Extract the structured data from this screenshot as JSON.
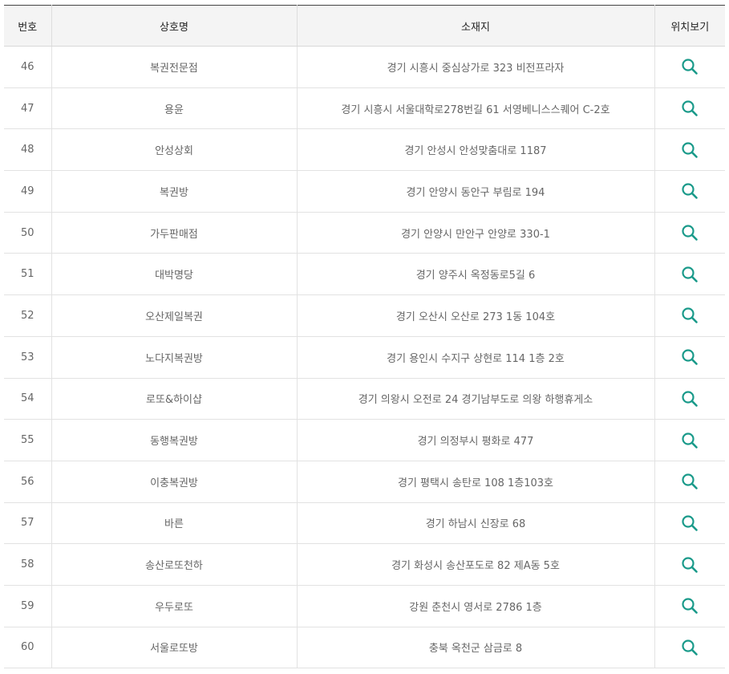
{
  "table": {
    "headers": {
      "no": "번호",
      "name": "상호명",
      "address": "소재지",
      "map": "위치보기"
    },
    "icon": "search-icon",
    "accent_color": "#1a9a8a",
    "rows": [
      {
        "no": "46",
        "name": "복권전문점",
        "address": "경기 시흥시 중심상가로 323 비전프라자"
      },
      {
        "no": "47",
        "name": "용윤",
        "address": "경기 시흥시 서울대학로278번길 61 서영베니스스퀘어 C-2호"
      },
      {
        "no": "48",
        "name": "안성상회",
        "address": "경기 안성시 안성맞춤대로 1187"
      },
      {
        "no": "49",
        "name": "복권방",
        "address": "경기 안양시 동안구 부림로 194"
      },
      {
        "no": "50",
        "name": "가두판매점",
        "address": "경기 안양시 만안구 안양로 330-1"
      },
      {
        "no": "51",
        "name": "대박명당",
        "address": "경기 양주시 옥정동로5길 6"
      },
      {
        "no": "52",
        "name": "오산제일복권",
        "address": "경기 오산시 오산로 273 1동 104호"
      },
      {
        "no": "53",
        "name": "노다지복권방",
        "address": "경기 용인시 수지구 상현로 114 1층 2호"
      },
      {
        "no": "54",
        "name": "로또&하이샵",
        "address": "경기 의왕시 오전로 24 경기남부도로 의왕 하행휴게소"
      },
      {
        "no": "55",
        "name": "동행복권방",
        "address": "경기 의정부시 평화로 477"
      },
      {
        "no": "56",
        "name": "이충복권방",
        "address": "경기 평택시 송탄로 108 1층103호"
      },
      {
        "no": "57",
        "name": "바른",
        "address": "경기 하남시 신장로 68"
      },
      {
        "no": "58",
        "name": "송산로또천하",
        "address": "경기 화성시 송산포도로 82 제A동 5호"
      },
      {
        "no": "59",
        "name": "우두로또",
        "address": "강원 춘천시 영서로 2786 1층"
      },
      {
        "no": "60",
        "name": "서울로또방",
        "address": "충북 옥천군 삼금로 8"
      }
    ]
  }
}
